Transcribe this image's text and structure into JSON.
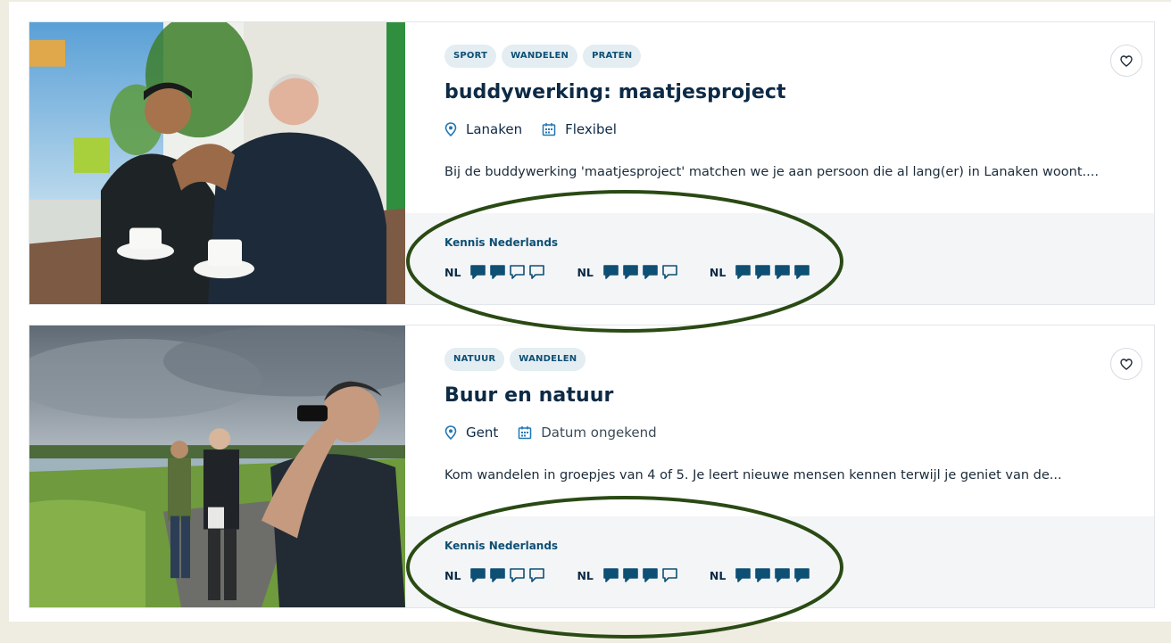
{
  "colors": {
    "accent": "#0e4f74",
    "tag_bg": "#e3edf2",
    "annotation_oval": "#2a4a14",
    "page_bg": "#efece2"
  },
  "cards": [
    {
      "tags": [
        "SPORT",
        "WANDELEN",
        "PRATEN"
      ],
      "title": "buddywerking: maatjesproject",
      "location": "Lanaken",
      "date": "Flexibel",
      "description": "Bij de buddywerking 'maatjesproject' matchen we je aan persoon die al lang(er) in Lanaken woont....",
      "skills_title": "Kennis Nederlands",
      "levels": [
        {
          "code": "NL",
          "filled": 2,
          "total": 4
        },
        {
          "code": "NL",
          "filled": 3,
          "total": 4
        },
        {
          "code": "NL",
          "filled": 4,
          "total": 4
        }
      ],
      "favorite_icon": "heart-icon",
      "location_icon": "map-pin-icon",
      "date_icon": "calendar-icon"
    },
    {
      "tags": [
        "NATUUR",
        "WANDELEN"
      ],
      "title": "Buur en natuur",
      "location": "Gent",
      "date": "Datum ongekend",
      "description": "Kom wandelen in groepjes van 4 of 5. Je leert nieuwe mensen kennen terwijl je geniet van de...",
      "skills_title": "Kennis Nederlands",
      "levels": [
        {
          "code": "NL",
          "filled": 2,
          "total": 4
        },
        {
          "code": "NL",
          "filled": 3,
          "total": 4
        },
        {
          "code": "NL",
          "filled": 4,
          "total": 4
        }
      ],
      "favorite_icon": "heart-icon",
      "location_icon": "map-pin-icon",
      "date_icon": "calendar-icon"
    }
  ]
}
